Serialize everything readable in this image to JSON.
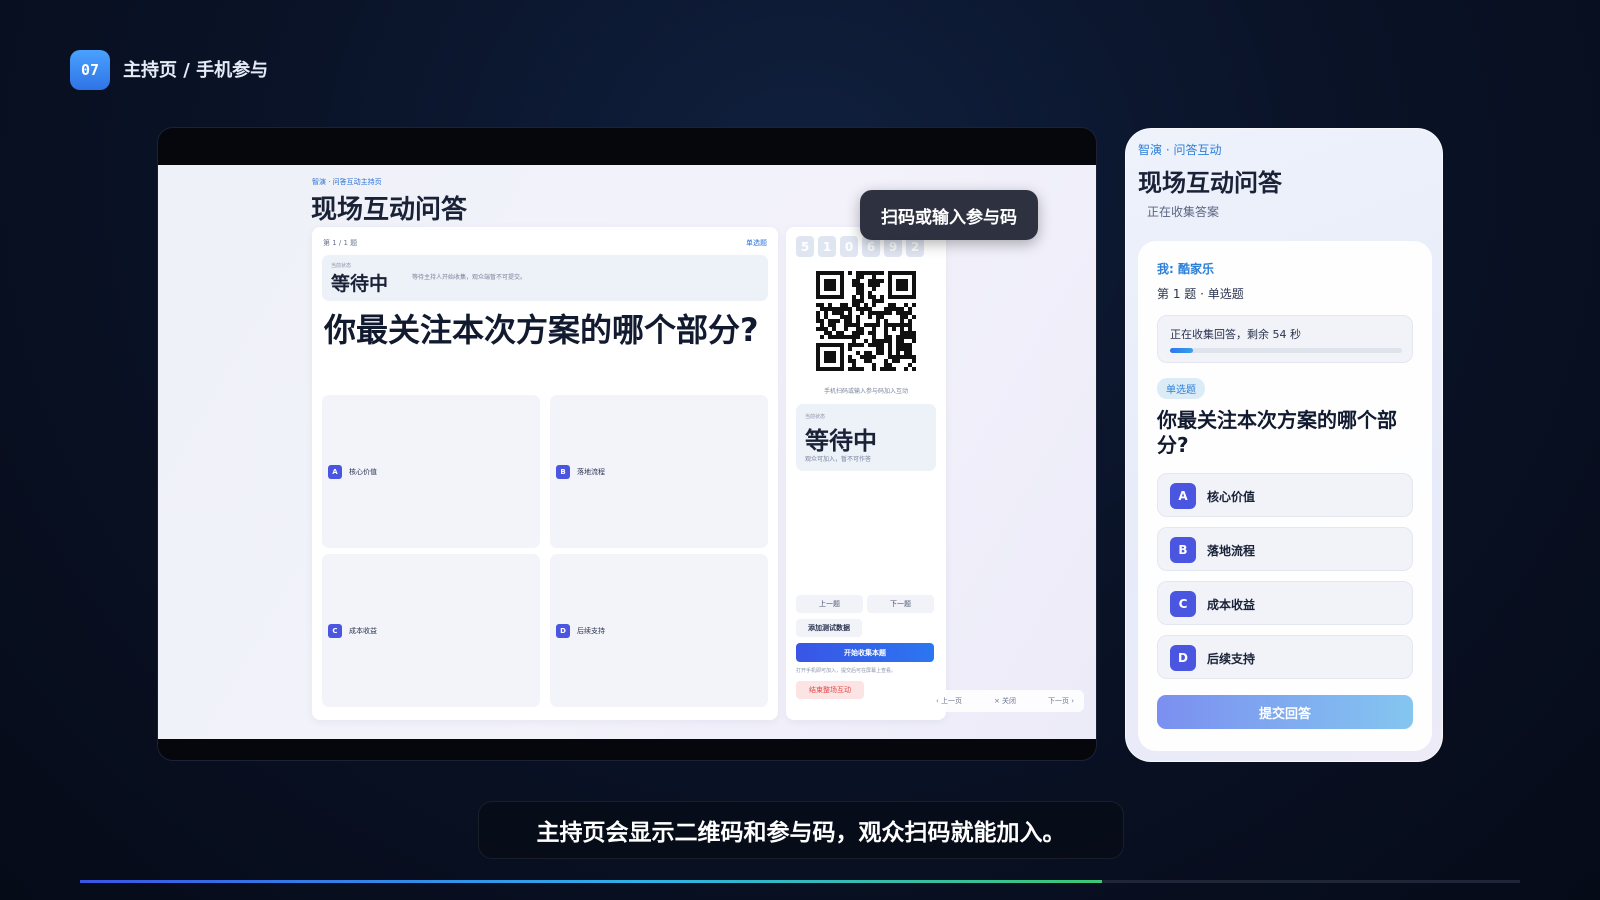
{
  "header": {
    "step": "07",
    "title": "主持页 / 手机参与"
  },
  "host": {
    "kicker": "智演 · 问答互动主持页",
    "title": "现场互动问答",
    "question_count": "第 1 / 1 题",
    "question_type": "单选题",
    "status_label": "当前状态",
    "status": "等待中",
    "status_note": "等待主持人开始收集，观众端暂不可提交。",
    "question": "你最关注本次方案的哪个部分?",
    "options": [
      {
        "letter": "A",
        "text": "核心价值"
      },
      {
        "letter": "B",
        "text": "落地流程"
      },
      {
        "letter": "C",
        "text": "成本收益"
      },
      {
        "letter": "D",
        "text": "后续支持"
      }
    ],
    "join_code": [
      "5",
      "1",
      "0",
      "6",
      "9",
      "2"
    ],
    "qr_caption": "手机扫码或输入参与码加入互动",
    "side_status_label": "当前状态",
    "side_status": "等待中",
    "side_status_note": "观众可加入，暂不可作答",
    "prev_question": "上一题",
    "next_question": "下一题",
    "add_test_data": "添加测试数据",
    "start_collect": "开始收集本题",
    "start_hint": "打开手机即可加入，提交后可在屏幕上查看。",
    "end_interaction": "结束整场互动",
    "pager": {
      "prev": "‹ 上一页",
      "close": "× 关闭",
      "next": "下一页 ›"
    },
    "tooltip": "扫码或输入参与码"
  },
  "phone": {
    "kicker": "智演 · 问答互动",
    "title": "现场互动问答",
    "subtitle": "正在收集答案",
    "me": "我: 酷家乐",
    "question_number": "第 1 题 · 单选题",
    "progress_text": "正在收集回答，剩余 54 秒",
    "progress_fraction": 0.1,
    "tag": "单选题",
    "question": "你最关注本次方案的哪个部分?",
    "options": [
      {
        "letter": "A",
        "text": "核心价值"
      },
      {
        "letter": "B",
        "text": "落地流程"
      },
      {
        "letter": "C",
        "text": "成本收益"
      },
      {
        "letter": "D",
        "text": "后续支持"
      }
    ],
    "submit": "提交回答"
  },
  "caption": "主持页会显示二维码和参与码，观众扫码就能加入。",
  "playback_progress": 0.71,
  "colors": {
    "accent": "#2f73e6",
    "option_badge": "#4a55e0",
    "danger": "#e04848"
  }
}
